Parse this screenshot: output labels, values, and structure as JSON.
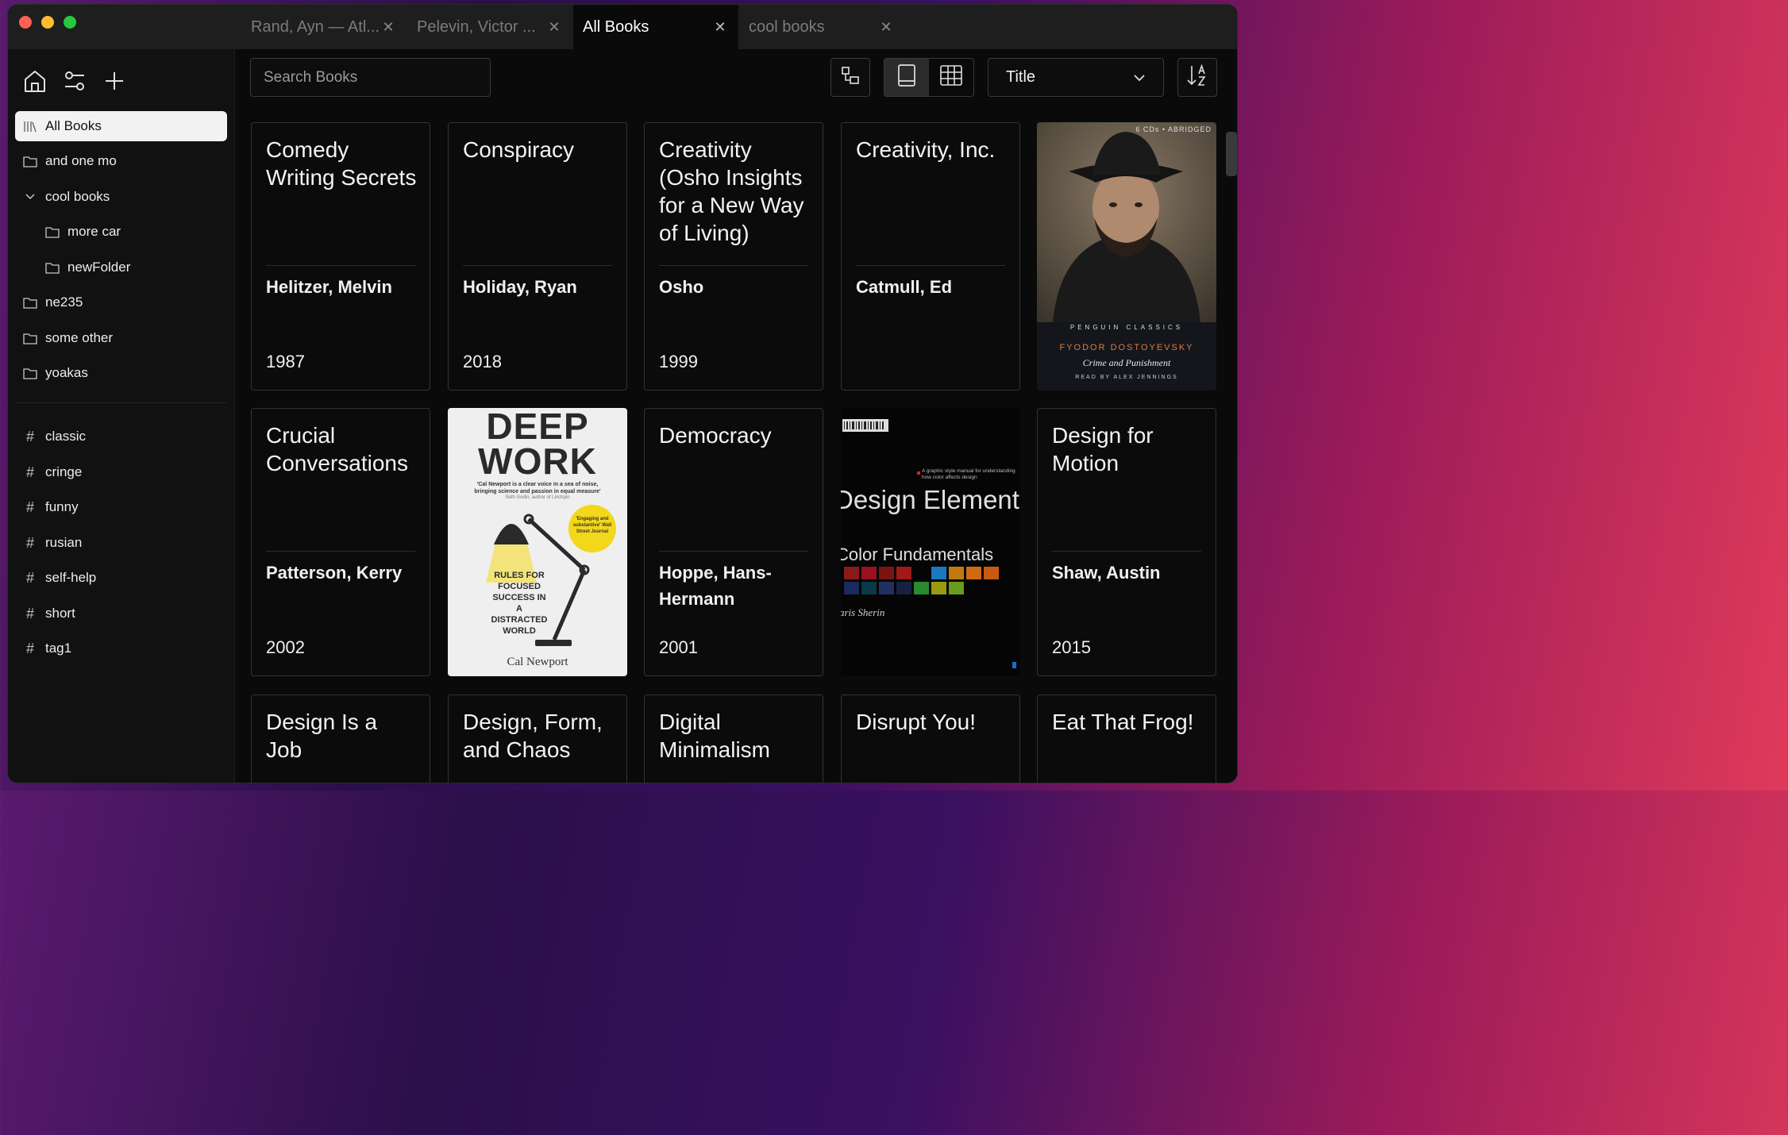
{
  "tabs": [
    {
      "label": "Rand, Ayn — Atl...",
      "active": false
    },
    {
      "label": "Pelevin, Victor ...",
      "active": false
    },
    {
      "label": "All Books",
      "active": true
    },
    {
      "label": "cool books",
      "active": false
    }
  ],
  "sidebar": {
    "folders": [
      {
        "label": "All Books",
        "icon": "library-icon",
        "active": true
      },
      {
        "label": "and one mo",
        "icon": "folder-icon"
      },
      {
        "label": "cool books",
        "icon": "chevron-down-icon"
      },
      {
        "label": "more car",
        "icon": "folder-icon"
      },
      {
        "label": "newFolder",
        "icon": "folder-icon"
      },
      {
        "label": "ne235",
        "icon": "folder-icon"
      },
      {
        "label": "some other",
        "icon": "folder-icon"
      },
      {
        "label": "yoakas",
        "icon": "folder-icon"
      }
    ],
    "tags": [
      "classic",
      "cringe",
      "funny",
      "rusian",
      "self-help",
      "short",
      "tag1"
    ]
  },
  "toolbar": {
    "search_placeholder": "Search Books",
    "sort_value": "Title"
  },
  "books": [
    {
      "title": "Comedy Writing Secrets",
      "author": "Helitzer, Melvin",
      "year": "1987"
    },
    {
      "title": "Conspiracy",
      "author": "Holiday, Ryan",
      "year": "2018"
    },
    {
      "title": "Creativity (Osho Insights for a New Way of Living)",
      "author": "Osho",
      "year": "1999"
    },
    {
      "title": "Creativity, Inc.",
      "author": "Catmull, Ed",
      "year": ""
    },
    {
      "cover": "crime-and-punishment",
      "cover_text": {
        "top": "6 CDs • ABRIDGED",
        "series": "PENGUIN CLASSICS",
        "author": "FYODOR DOSTOYEVSKY",
        "title": "Crime and Punishment",
        "reader": "READ BY ALEX JENNINGS"
      }
    },
    {
      "title": "Crucial Conversations",
      "author": "Patterson, Kerry",
      "year": "2002"
    },
    {
      "cover": "deep-work",
      "cover_text": {
        "title1": "DEEP",
        "title2": "WORK",
        "blurb": "'Cal Newport is a clear voice in a sea of noise, bringing science and passion in equal measure'",
        "blurb_by": "Seth Godin, author of Linchpin",
        "badge": "'Engaging and substantive' Wall Street Journal",
        "subtitle": "RULES FOR FOCUSED SUCCESS IN A DISTRACTED WORLD",
        "author": "Cal Newport"
      }
    },
    {
      "title": "Democracy",
      "author": "Hoppe, Hans-Hermann",
      "year": "2001"
    },
    {
      "cover": "design-elements",
      "cover_text": {
        "tagline": "A graphic style manual for understanding how color affects design",
        "title": "Design Elements:",
        "subtitle": "Color Fundamentals",
        "author": "Aaris Sherin"
      }
    },
    {
      "title": "Design for Motion",
      "author": "Shaw, Austin",
      "year": "2015"
    },
    {
      "title": "Design Is a Job",
      "author": "",
      "year": ""
    },
    {
      "title": "Design, Form, and Chaos",
      "author": "",
      "year": ""
    },
    {
      "title": "Digital Minimalism",
      "author": "",
      "year": ""
    },
    {
      "title": "Disrupt You!",
      "author": "",
      "year": ""
    },
    {
      "title": "Eat That Frog!",
      "author": "",
      "year": ""
    }
  ]
}
